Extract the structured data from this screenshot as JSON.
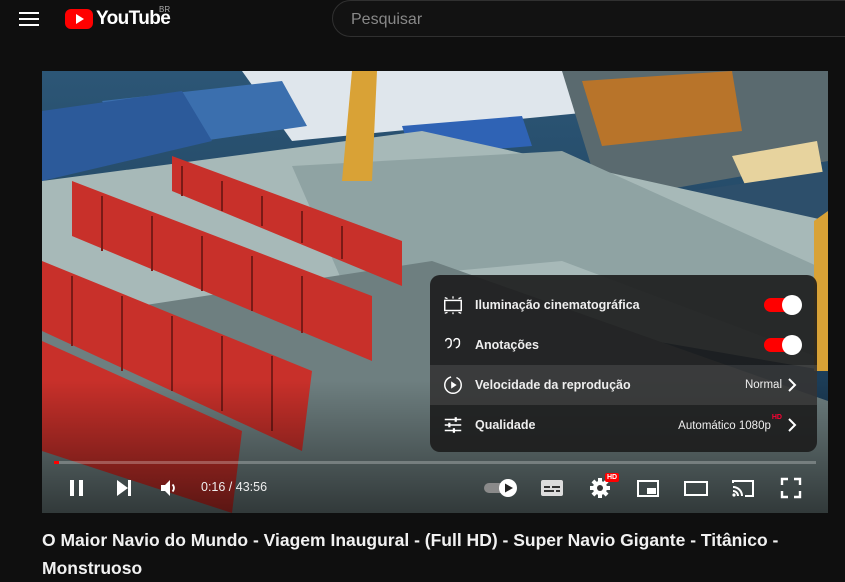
{
  "header": {
    "logo_text": "YouTube",
    "country": "BR",
    "search_placeholder": "Pesquisar"
  },
  "player": {
    "progress_fraction": 0.006,
    "time_display": "0:16 / 43:56",
    "settings_menu": {
      "items": [
        {
          "label": "Iluminação cinematográfica",
          "icon": "ambient-mode-icon",
          "type": "toggle",
          "on": true
        },
        {
          "label": "Anotações",
          "icon": "annotations-icon",
          "type": "toggle",
          "on": true
        },
        {
          "label": "Velocidade da reprodução",
          "icon": "playback-speed-icon",
          "type": "submenu",
          "value": "Normal"
        },
        {
          "label": "Qualidade",
          "icon": "quality-icon",
          "type": "submenu",
          "value": "Automático 1080p",
          "badge": "HD"
        }
      ]
    },
    "settings_badge": "HD"
  },
  "video": {
    "title": "O Maior Navio do Mundo - Viagem Inaugural - (Full HD) - Super Navio Gigante - Titânico - Monstruoso"
  },
  "colors": {
    "accent": "#ff0000",
    "background": "#0f0f0f"
  }
}
